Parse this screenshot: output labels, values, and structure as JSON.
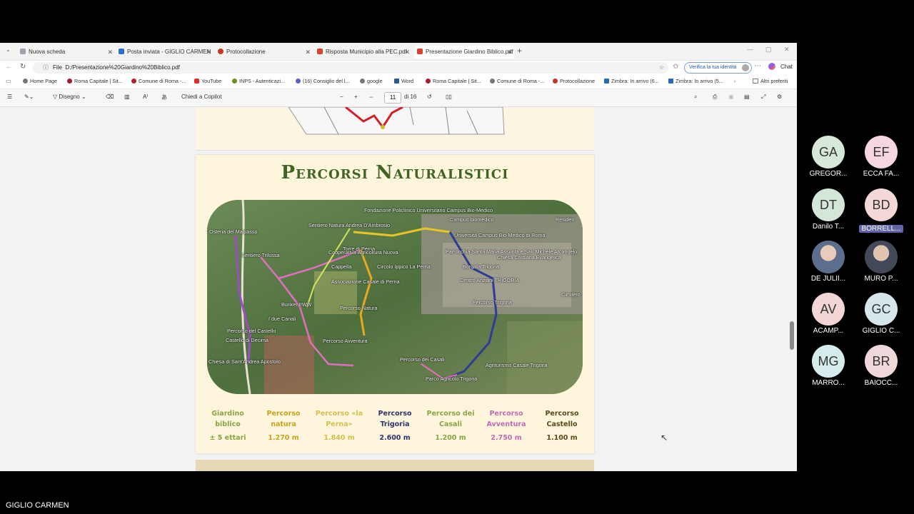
{
  "tabs": [
    {
      "label": "Nuova scheda",
      "color": "#7c8a9c"
    },
    {
      "label": "Posta inviata - GIGLIO CARMEN -",
      "color": "#2f6fc4"
    },
    {
      "label": "Protocollazione",
      "color": "#c0392b"
    },
    {
      "label": "Risposta Municipio alla PEC.pdf",
      "color": "#d9412f"
    },
    {
      "label": "Presentazione Giardino Biblico.pdf",
      "color": "#d9412f"
    }
  ],
  "address": {
    "scheme": "File",
    "url": "D:/Presentazione%20Giardino%20Biblico.pdf",
    "verify": "Verifica la tua identità",
    "chat": "Chat"
  },
  "bookmarks": [
    "Home Page",
    "Roma Capitale | Sit...",
    "Comune di Roma -...",
    "YouTube",
    "INPS - Autenticazi...",
    "(16) Consiglio del l...",
    "google",
    "Word",
    "Roma Capitale | Sit...",
    "Comune di Roma -...",
    "Protocollazione",
    "Zimbra: In arrivo (6...",
    "Zimbra: In arrivo (5...",
    "Altri preferiti"
  ],
  "pdfbar": {
    "draw": "Disegno",
    "copilot": "Chiedi a Copilot",
    "page": "11",
    "of": "di 16"
  },
  "slide": {
    "title": "Percorsi Naturalistici",
    "map_labels": [
      "Fondazione Policlinico Universitario Campus Bio-Medico",
      "Campus biomedico",
      "Università Campus Bio-Medico di Roma",
      "Residen",
      "Osteria del Malpasso",
      "Sentiero Natura Andrea D'Ambrosio",
      "Torre di Perna",
      "Cooperativa Agricoltura Nuova",
      "Parrocchia Santa Maria Assunta e San Michele Arcangelo",
      "Chiesa Cristiana Evangelica",
      "Sentiero Trilussa",
      "Cappella",
      "Circolo Ippico La Perna",
      "Borgata Trigoria",
      "Associazione Casale di Perna",
      "Centro Anziani TRIGORIA",
      "Cimitero",
      "Bunker IIWW",
      "Percorso Natura",
      "Percorso Trigoria",
      "I due Canali",
      "Percorso del Castello",
      "Percorso Avventura",
      "Castello di Decima",
      "Chiesa di Sant'Andrea Apostolo",
      "Percorso dei Casali",
      "Agriturismo Casale Trigoria",
      "Parco Agricolo Trigoria"
    ],
    "legend": [
      {
        "name": "Giardino biblico",
        "dist": "± 5 ettari",
        "color": "#8aa548"
      },
      {
        "name": "Percorso natura",
        "dist": "1.270 m",
        "color": "#c9a21c"
      },
      {
        "name": "Percorso «la Perna»",
        "dist": "1.840 m",
        "color": "#d4c050"
      },
      {
        "name": "Percorso Trigoria",
        "dist": "2.600 m",
        "color": "#2c3470"
      },
      {
        "name": "Percorso dei Casali",
        "dist": "1.200 m",
        "color": "#8aa548"
      },
      {
        "name": "Percorso Avventura",
        "dist": "2.750 m",
        "color": "#c36bb5"
      },
      {
        "name": "Percorso Castello",
        "dist": "1.100 m",
        "color": "#5a4a1a"
      }
    ]
  },
  "participants": [
    {
      "initials": "GA",
      "name": "GREGOR...",
      "bg": "#d8e8d8"
    },
    {
      "initials": "EF",
      "name": "ECCA FA...",
      "bg": "#f6d6df"
    },
    {
      "initials": "DT",
      "name": "Danilo T...",
      "bg": "#d4e6d8"
    },
    {
      "initials": "BD",
      "name": "BORRELL...",
      "bg": "#f4d8d8"
    },
    {
      "initials": "",
      "name": "DE JULII...",
      "bg": "#c8ccd4"
    },
    {
      "initials": "",
      "name": "MURO P...",
      "bg": "#c4c8cc"
    },
    {
      "initials": "AV",
      "name": "ACAMP...",
      "bg": "#f2d6d6"
    },
    {
      "initials": "GC",
      "name": "GIGLIO C...",
      "bg": "#d6e6ea"
    },
    {
      "initials": "MG",
      "name": "MARRO...",
      "bg": "#d4ecec"
    },
    {
      "initials": "BR",
      "name": "BAIOCC...",
      "bg": "#f0d8da"
    }
  ],
  "speaker": "GIGLIO CARMEN"
}
